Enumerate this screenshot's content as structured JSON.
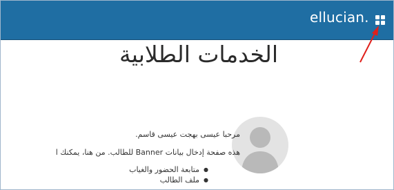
{
  "header": {
    "brand": "ellucian.",
    "menu_icon": "grid-menu-icon",
    "background": "#1f6ea3"
  },
  "main": {
    "title": "الخدمات الطلابية",
    "welcome": "مرحبا عيسى بهجت عيسى قاسم.",
    "description": "هذه صفحة إدخال بيانات Banner للطالب. من هنا، يمكنك ا",
    "links": [
      "متابعة الحضور والغياب",
      "ملف الطالب"
    ],
    "avatar_icon": "default-user-avatar-icon"
  },
  "annotation": {
    "arrow_color": "#e0201b"
  }
}
